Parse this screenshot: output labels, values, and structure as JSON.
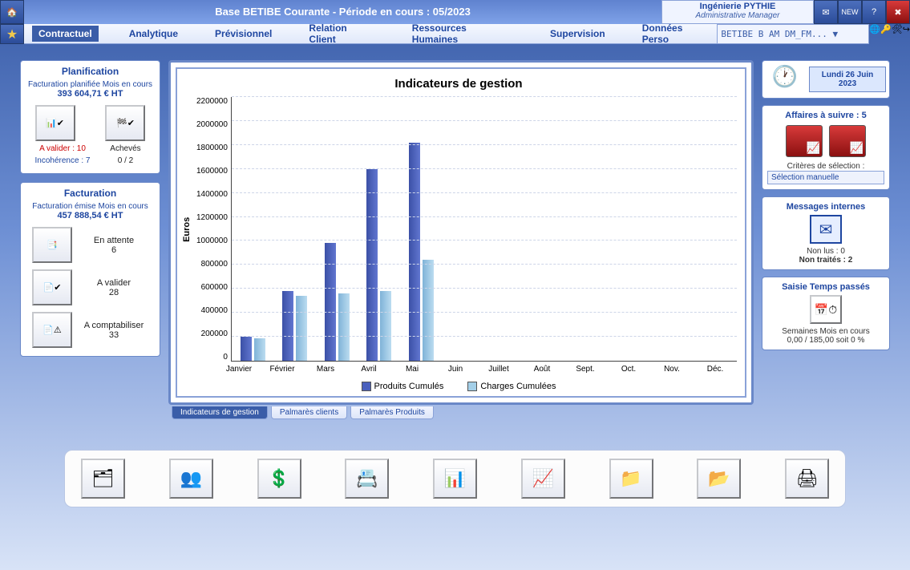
{
  "header": {
    "title": "Base BETIBE Courante  -  Période en cours  :  05/2023",
    "org": "Ingénierie PYTHIE",
    "role": "Administrative Manager",
    "user_selector": "BETIBE    B AM  DM_FM... ▼"
  },
  "tabs": [
    "Contractuel",
    "Analytique",
    "Prévisionnel",
    "Relation Client",
    "Ressources Humaines",
    "Supervision",
    "Données Perso"
  ],
  "tabs_active_index": 0,
  "left": {
    "planif": {
      "title": "Planification",
      "sub": "Facturation planifiée Mois en cours",
      "amount": "393 604,71 € HT",
      "a_valider_label": "A valider : 10",
      "incoherence_label": "Incohérence : 7",
      "acheves_label": "Achevés",
      "acheves_count": "0 / 2"
    },
    "fact": {
      "title": "Facturation",
      "sub": "Facturation émise Mois en cours",
      "amount": "457 888,54 € HT",
      "rows": [
        {
          "label": "En attente",
          "count": "6"
        },
        {
          "label": "A valider",
          "count": "28"
        },
        {
          "label": "A comptabiliser",
          "count": "33"
        }
      ]
    }
  },
  "chart_data": {
    "type": "bar",
    "title": "Indicateurs de gestion",
    "ylabel": "Euros",
    "ylim": [
      0,
      2200000
    ],
    "ystep": 200000,
    "categories": [
      "Janvier",
      "Février",
      "Mars",
      "Avril",
      "Mai",
      "Juin",
      "Juillet",
      "Août",
      "Sept.",
      "Oct.",
      "Nov.",
      "Déc."
    ],
    "series": [
      {
        "name": "Produits Cumulés",
        "values": [
          200000,
          580000,
          980000,
          1600000,
          1820000,
          0,
          0,
          0,
          0,
          0,
          0,
          0
        ]
      },
      {
        "name": "Charges Cumulées",
        "values": [
          190000,
          540000,
          560000,
          580000,
          840000,
          0,
          0,
          0,
          0,
          0,
          0,
          0
        ]
      }
    ]
  },
  "chart_tabs": [
    "Indicateurs de gestion",
    "Palmarès clients",
    "Palmarès Produits"
  ],
  "chart_tabs_active": 0,
  "right": {
    "date": "Lundi 26 Juin 2023",
    "affaires_title": "Affaires à suivre : 5",
    "criteres_label": "Critères de sélection :",
    "criteres_value": "Sélection manuelle",
    "messages_title": "Messages internes",
    "non_lus": "Non lus : 0",
    "non_traites": "Non traités : 2",
    "saisie_title": "Saisie Temps passés",
    "saisie_sub": "Semaines Mois en cours",
    "saisie_val": "0,00 / 185,00 soit 0 %"
  },
  "dock_icons": [
    "module-1",
    "module-2",
    "module-3",
    "module-4",
    "module-5",
    "module-6",
    "folder-1",
    "folder-2",
    "printer"
  ]
}
